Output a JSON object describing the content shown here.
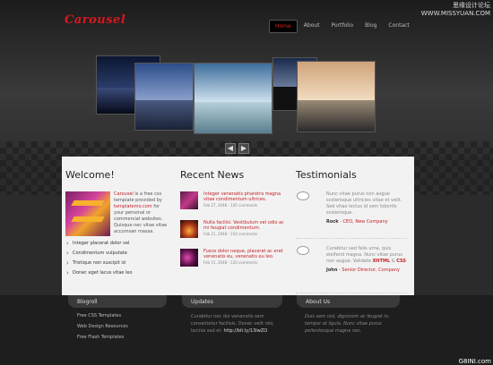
{
  "header": {
    "logo": "Carousel",
    "nav": [
      "Home",
      "About",
      "Portfolio",
      "Blog",
      "Contact"
    ],
    "watermark_line1": "思缘设计论坛",
    "watermark_line2": "WWW.MISSYUAN.COM"
  },
  "carousel": {
    "prev_label": "◀",
    "next_label": "▶"
  },
  "welcome": {
    "title": "Welcome!",
    "brand": "Carousel",
    "text_a": " is a free css template provided by ",
    "link": "templatemo.com",
    "text_b": " for your personal or commercial websites. Quisque nec vitae vitae accumsan massa.",
    "items": [
      "Integer placerat dolor vel",
      "Condimentum vulputate",
      "Tristique non suscipit id",
      "Donec eget lacus vitae leo"
    ]
  },
  "news": {
    "title": "Recent News",
    "items": [
      {
        "title": "Integer venenatis pharetra magna vitae condimentum ultrices.",
        "date": "Feb 27, 2048 - 145 comments"
      },
      {
        "title": "Nulla facilisi. Vestibulum vel odio ac mi feugiat condimentum.",
        "date": "Feb 21, 2048 - 154 comments"
      },
      {
        "title": "Fusce dolor neque, placerat ac erat venenatis eu, venenatis eu leo.",
        "date": "Feb 15, 2048 - 120 comments"
      }
    ]
  },
  "testimonials": {
    "title": "Testimonials",
    "items": [
      {
        "quote": "Nunc vitae purus non augue scelerisque ultricies vitae et velit. Sed vitae lectus id sem lobortis scelerisque.",
        "name": "Rock",
        "role": " - CEO, New Company"
      },
      {
        "quote": "Curabitur sed felis urna, quis eleifend magna. Nunc vitae purus non augue. Validate ",
        "xhtml": "XHTML",
        "amp": " & ",
        "css": "CSS",
        "name": "John",
        "role": " - Senior Director, Company"
      }
    ]
  },
  "footer": {
    "blogroll_title": "Blogroll",
    "blogroll": [
      "Free CSS Templates",
      "Web Design Resources",
      "Free Flash Templates"
    ],
    "updates_title": "Updates",
    "updates_text": "Curabitur nec dui venenatis sem consectetur facilisis. Donec velit nisi, lacinia sed et. ",
    "updates_link": "http://bit.ly/13IwZO",
    "about_title": "About Us",
    "about_text": "Duis sem nisl, dignissim ac feugiat in, tempor at ligula. Nunc vitae purus pellentesque magna nec.",
    "badge": "G8INI.com"
  }
}
